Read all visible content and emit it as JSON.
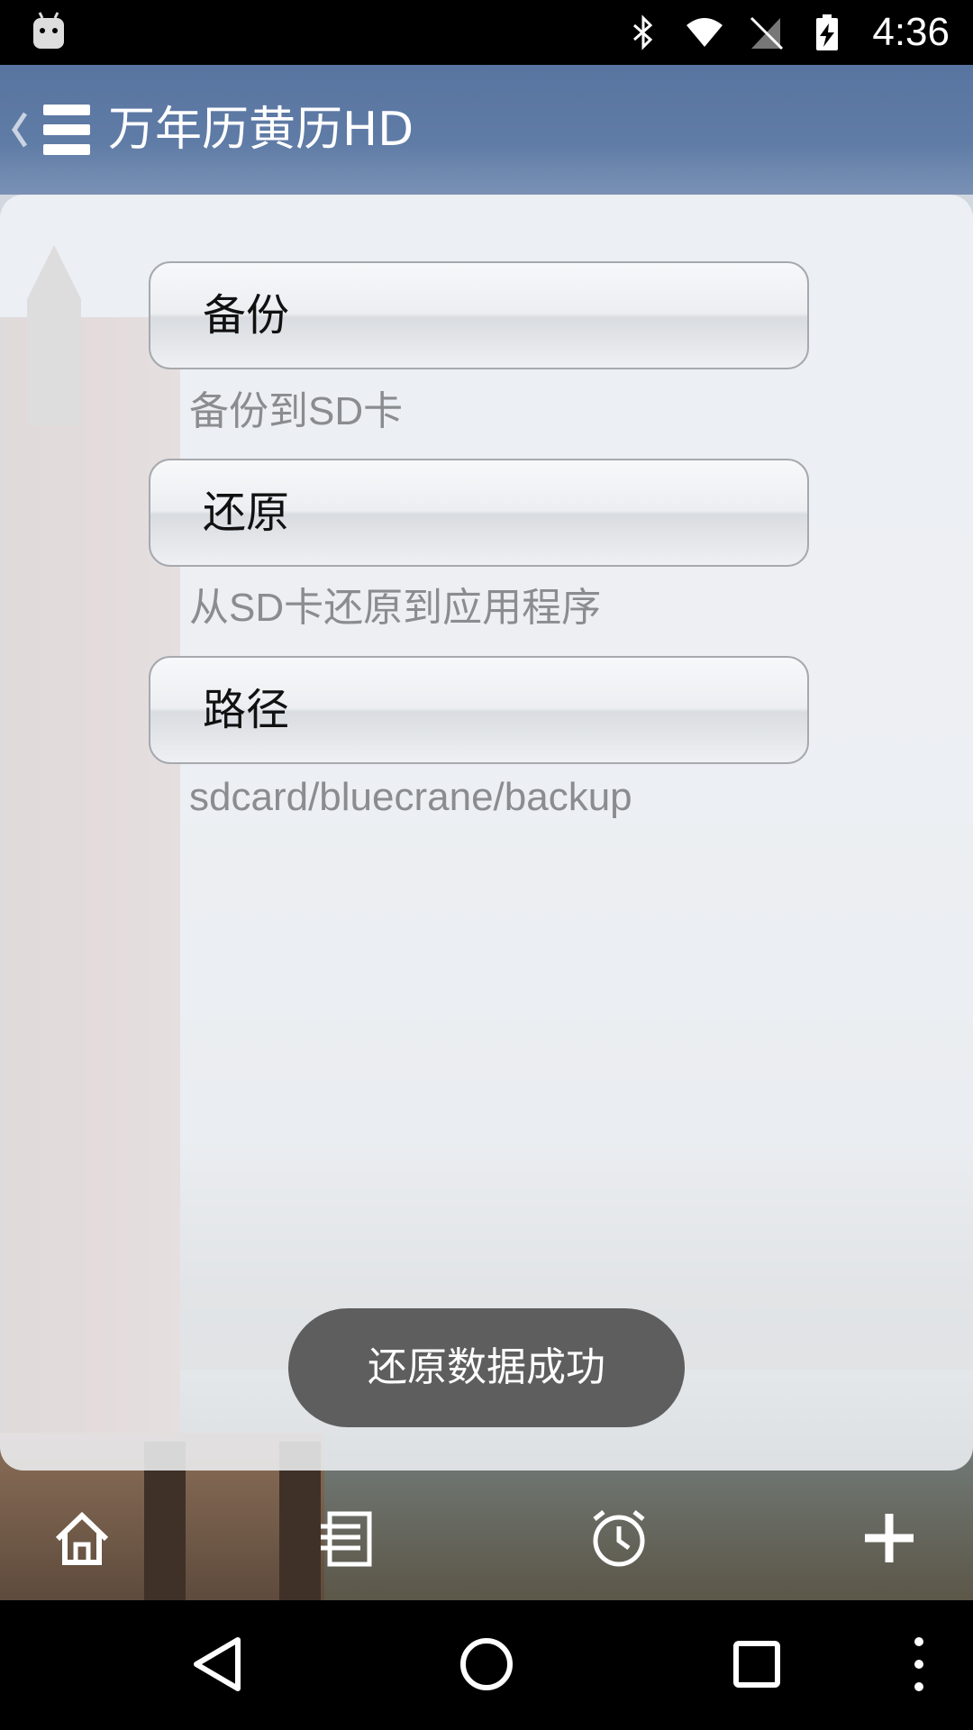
{
  "status_bar": {
    "time": "4:36",
    "icons": [
      "android-icon",
      "bluetooth-icon",
      "wifi-icon",
      "no-sim-icon",
      "battery-charging-icon"
    ]
  },
  "app_bar": {
    "title": "万年历黄历HD"
  },
  "options": [
    {
      "label": "备份",
      "description": "备份到SD卡"
    },
    {
      "label": "还原",
      "description": "从SD卡还原到应用程序"
    },
    {
      "label": "路径",
      "description": "sdcard/bluecrane/backup"
    }
  ],
  "toast": {
    "message": "还原数据成功"
  },
  "bottom_toolbar": {
    "icons": [
      "home-icon",
      "list-icon",
      "alarm-clock-icon",
      "plus-icon"
    ]
  },
  "nav_bar": {
    "icons": [
      "back-icon",
      "home-circle-icon",
      "recents-icon",
      "overflow-menu-icon"
    ]
  },
  "colors": {
    "header": "#5874a0",
    "toast": "#5e5e5e",
    "description_text": "#8a8c8f"
  }
}
